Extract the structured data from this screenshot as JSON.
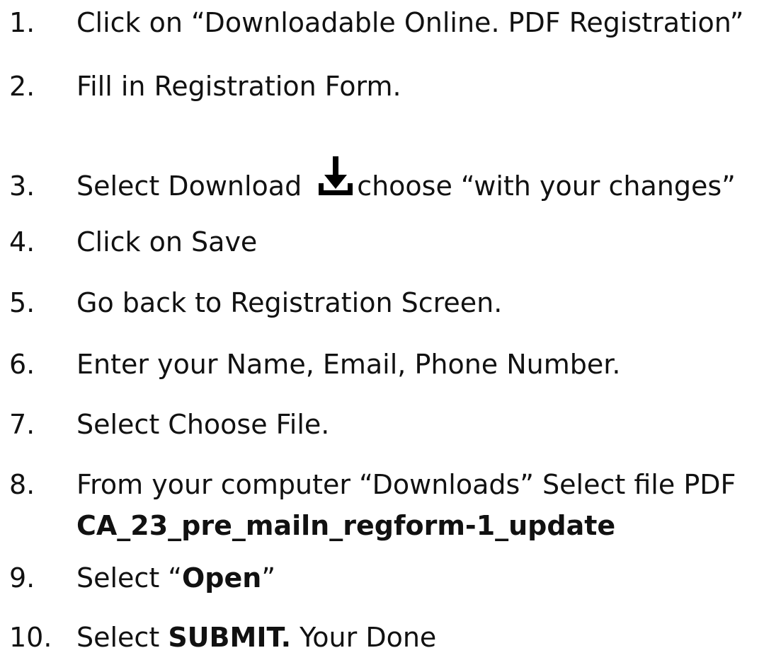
{
  "steps": [
    {
      "num": "1.",
      "text": "Click on “Downloadable Online. PDF Registration”"
    },
    {
      "num": "2.",
      "text": "Fill in Registration Form."
    },
    {
      "num": "3.",
      "before": "Select Download",
      "after": "choose “with your changes”",
      "icon": "download-icon"
    },
    {
      "num": "4.",
      "text": "Click on Save"
    },
    {
      "num": "5.",
      "text": "Go back to Registration Screen."
    },
    {
      "num": "6.",
      "text": "Enter your Name, Email, Phone Number."
    },
    {
      "num": "7.",
      "text": "Select Choose File."
    },
    {
      "num": "8.",
      "text": "From your computer “Downloads” Select file PDF",
      "filename": "CA_23_pre_mailn_regform-1_update"
    },
    {
      "num": "9.",
      "before": "Select “",
      "bold": "Open",
      "after": "”"
    },
    {
      "num": "10.",
      "before": "Select ",
      "bold": "SUBMIT.",
      "after": " Your Done"
    }
  ]
}
